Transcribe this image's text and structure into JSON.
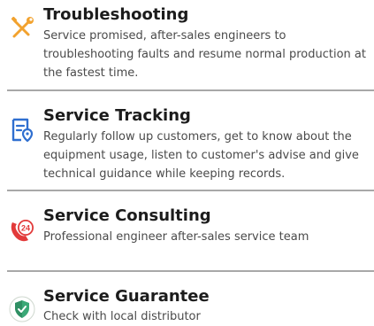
{
  "services": [
    {
      "title": "Troubleshooting",
      "description": "Service promised, after-sales engineers to troubleshooting faults and resume normal production at the fastest time.",
      "icon": "wrench-screwdriver-icon",
      "icon_color": "#f2a22e"
    },
    {
      "title": "Service Tracking",
      "description": "Regularly follow up customers, get to know about the equipment usage, listen to customer's advise and give technical guidance while keeping records.",
      "icon": "document-location-icon",
      "icon_color": "#2f6fd0"
    },
    {
      "title": "Service Consulting",
      "description": "Professional engineer after-sales service team",
      "icon": "24-hour-phone-icon",
      "icon_color": "#e23a3a",
      "icon_text": "24"
    },
    {
      "title": "Service Guarantee",
      "description": "Check with local distributor",
      "icon": "shield-check-icon",
      "icon_color": "#3aa876"
    }
  ]
}
